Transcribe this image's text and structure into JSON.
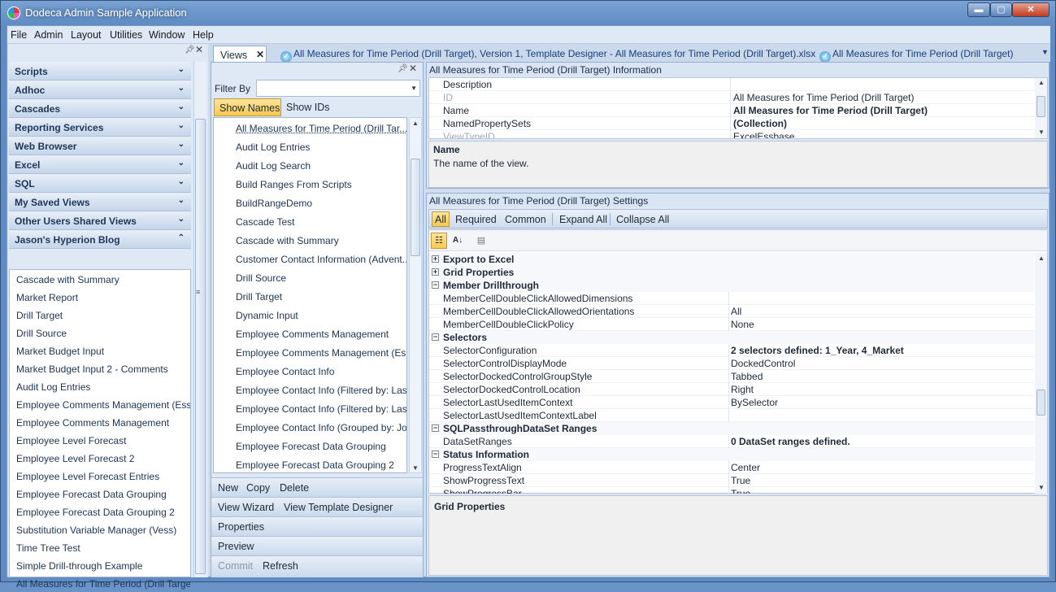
{
  "window": {
    "title": "Dodeca Admin Sample Application",
    "min": "▬",
    "max": "▢",
    "close": "✕"
  },
  "menu": [
    "File",
    "Admin",
    "Layout",
    "Utilities",
    "Window",
    "Help"
  ],
  "left_panel": {
    "groups": [
      {
        "label": "Scripts",
        "chevron": "⌄"
      },
      {
        "label": "Adhoc",
        "chevron": "⌄"
      },
      {
        "label": "Cascades",
        "chevron": "⌄"
      },
      {
        "label": "Reporting Services",
        "chevron": "⌄"
      },
      {
        "label": "Web Browser",
        "chevron": "⌄"
      },
      {
        "label": "Excel",
        "chevron": "⌄"
      },
      {
        "label": "SQL",
        "chevron": "⌄"
      },
      {
        "label": "My Saved Views",
        "chevron": "⌄"
      },
      {
        "label": "Other Users Shared Views",
        "chevron": "⌄"
      },
      {
        "label": "Jason's Hyperion Blog",
        "chevron": "⌃"
      }
    ],
    "items": [
      "Cascade with Summary",
      "Market Report",
      "Drill Target",
      "Drill Source",
      "Market Budget Input",
      "Market Budget Input 2 - Comments",
      "Audit Log Entries",
      "Employee Comments Management (Ess...",
      "Employee Comments Management",
      "Employee Level Forecast",
      "Employee Level Forecast 2",
      "Employee Level Forecast Entries",
      "Employee Forecast Data Grouping",
      "Employee Forecast Data Grouping 2",
      "Substitution Variable Manager (Vess)",
      "Time Tree Test",
      "Simple Drill-through Example",
      "All Measures for Time Period (Drill Targe..."
    ]
  },
  "tabs": {
    "views_label": "Views",
    "docs": [
      "All Measures for Time Period (Drill Target), Version 1, Template Designer - All Measures for Time Period (Drill Target).xlsx",
      "All Measures for Time Period (Drill Target)"
    ]
  },
  "views_panel": {
    "filter_label": "Filter By",
    "filter_value": "",
    "show_names": "Show Names",
    "show_ids": "Show IDs",
    "items": [
      "All Measures for Time Period (Drill Tar...",
      "Audit Log Entries",
      "Audit Log Search",
      "Build Ranges From Scripts",
      "BuildRangeDemo",
      "Cascade Test",
      "Cascade with Summary",
      "Customer Contact Information (Advent...",
      "Drill Source",
      "Drill Target",
      "Dynamic Input",
      "Employee Comments Management",
      "Employee Comments Management (Es...",
      "Employee Contact Info",
      "Employee Contact Info (Filtered by: Las...",
      "Employee Contact Info (Filtered by: Las...",
      "Employee Contact Info (Grouped by: Jo...",
      "Employee Forecast Data Grouping",
      "Employee Forecast Data Grouping 2"
    ],
    "actions": {
      "new": "New",
      "copy": "Copy",
      "delete": "Delete",
      "view_wizard": "View Wizard",
      "view_template_designer": "View Template Designer",
      "properties": "Properties",
      "preview": "Preview",
      "commit": "Commit",
      "refresh": "Refresh"
    }
  },
  "info_panel": {
    "title": "All Measures for Time Period (Drill Target) Information",
    "rows": [
      {
        "key": "Description",
        "value": ""
      },
      {
        "key": "ID",
        "value": "All Measures for Time Period (Drill Target)"
      },
      {
        "key": "Name",
        "value": "All Measures for Time Period (Drill Target)"
      },
      {
        "key": "NamedPropertySets",
        "value": "(Collection)"
      },
      {
        "key": "ViewTypeID",
        "value": "ExcelEssbase"
      }
    ],
    "desc_title": "Name",
    "desc_text": "The name of the view."
  },
  "settings_panel": {
    "title": "All Measures for Time Period (Drill Target) Settings",
    "filters": [
      "All",
      "Required",
      "Common",
      "Expand All",
      "Collapse All"
    ],
    "rows": [
      {
        "type": "cat",
        "exp": "+",
        "key": "Export to Excel"
      },
      {
        "type": "cat",
        "exp": "+",
        "key": "Grid Properties"
      },
      {
        "type": "cat",
        "exp": "−",
        "key": "Member Drillthrough"
      },
      {
        "type": "prop",
        "key": "MemberCellDoubleClickAllowedDimensions",
        "value": ""
      },
      {
        "type": "prop",
        "key": "MemberCellDoubleClickAllowedOrientations",
        "value": "All"
      },
      {
        "type": "prop",
        "key": "MemberCellDoubleClickPolicy",
        "value": "None"
      },
      {
        "type": "cat",
        "exp": "−",
        "key": "Selectors"
      },
      {
        "type": "prop",
        "key": "SelectorConfiguration",
        "value": "2 selectors defined: 1_Year, 4_Market",
        "bold": true
      },
      {
        "type": "prop",
        "key": "SelectorControlDisplayMode",
        "value": "DockedControl"
      },
      {
        "type": "prop",
        "key": "SelectorDockedControlGroupStyle",
        "value": "Tabbed"
      },
      {
        "type": "prop",
        "key": "SelectorDockedControlLocation",
        "value": "Right"
      },
      {
        "type": "prop",
        "key": "SelectorLastUsedItemContext",
        "value": "BySelector"
      },
      {
        "type": "prop",
        "key": "SelectorLastUsedItemContextLabel",
        "value": ""
      },
      {
        "type": "cat",
        "exp": "−",
        "key": "SQLPassthroughDataSet Ranges"
      },
      {
        "type": "prop",
        "key": "DataSetRanges",
        "value": "0 DataSet ranges defined.",
        "bold": true
      },
      {
        "type": "cat",
        "exp": "−",
        "key": "Status Information"
      },
      {
        "type": "prop",
        "key": "ProgressTextAlign",
        "value": "Center"
      },
      {
        "type": "prop",
        "key": "ShowProgressText",
        "value": "True"
      },
      {
        "type": "prop",
        "key": "ShowProgressBar",
        "value": "True"
      }
    ],
    "desc_title": "Grid Properties"
  }
}
